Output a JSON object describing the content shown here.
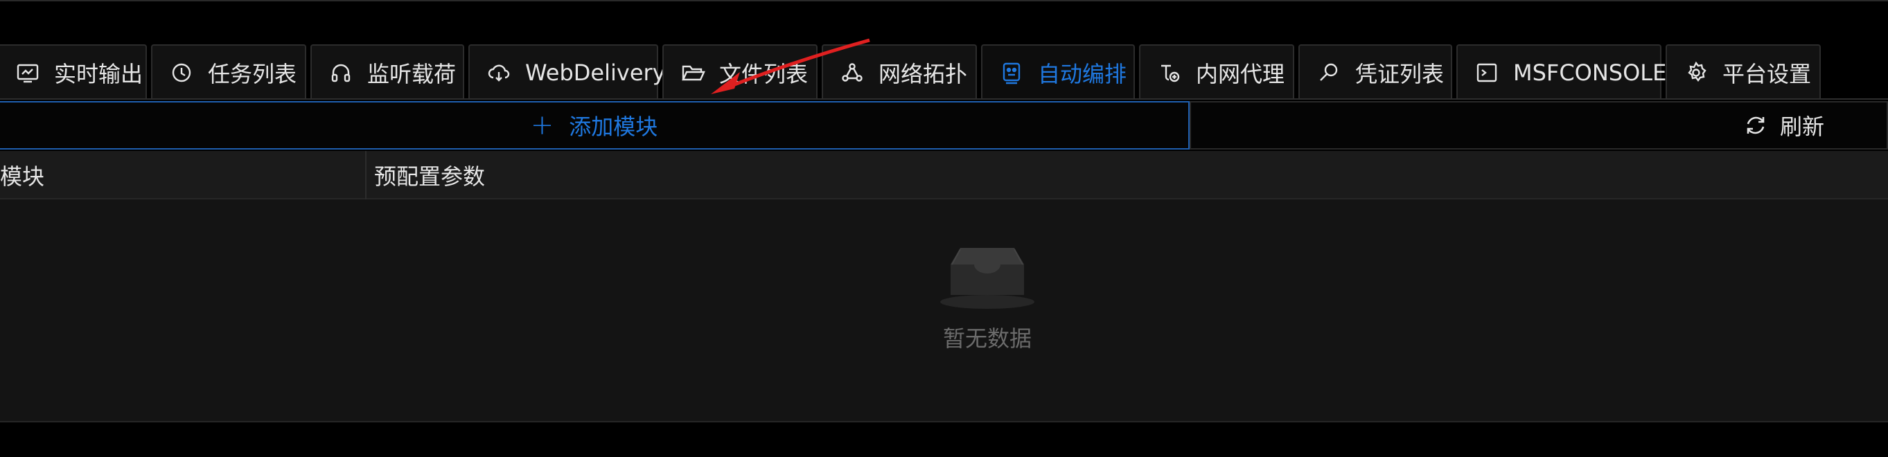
{
  "tabs": [
    {
      "label": "实时输出",
      "icon": "monitor-icon"
    },
    {
      "label": "任务列表",
      "icon": "history-icon"
    },
    {
      "label": "监听载荷",
      "icon": "headset-icon"
    },
    {
      "label": "WebDelivery",
      "icon": "cloud-download-icon"
    },
    {
      "label": "文件列表",
      "icon": "folder-open-icon"
    },
    {
      "label": "网络拓扑",
      "icon": "network-icon"
    },
    {
      "label": "自动编排",
      "icon": "robot-icon",
      "active": true
    },
    {
      "label": "内网代理",
      "icon": "proxy-icon"
    },
    {
      "label": "凭证列表",
      "icon": "key-search-icon"
    },
    {
      "label": "MSFCONSOLE",
      "icon": "terminal-icon"
    },
    {
      "label": "平台设置",
      "icon": "gear-icon"
    }
  ],
  "toolbar": {
    "add_label": "添加模块",
    "refresh_label": "刷新"
  },
  "table": {
    "columns": [
      "模块",
      "预配置参数"
    ],
    "empty_text": "暂无数据"
  },
  "colors": {
    "accent": "#1f78e0",
    "annotation_arrow": "#e02020"
  }
}
